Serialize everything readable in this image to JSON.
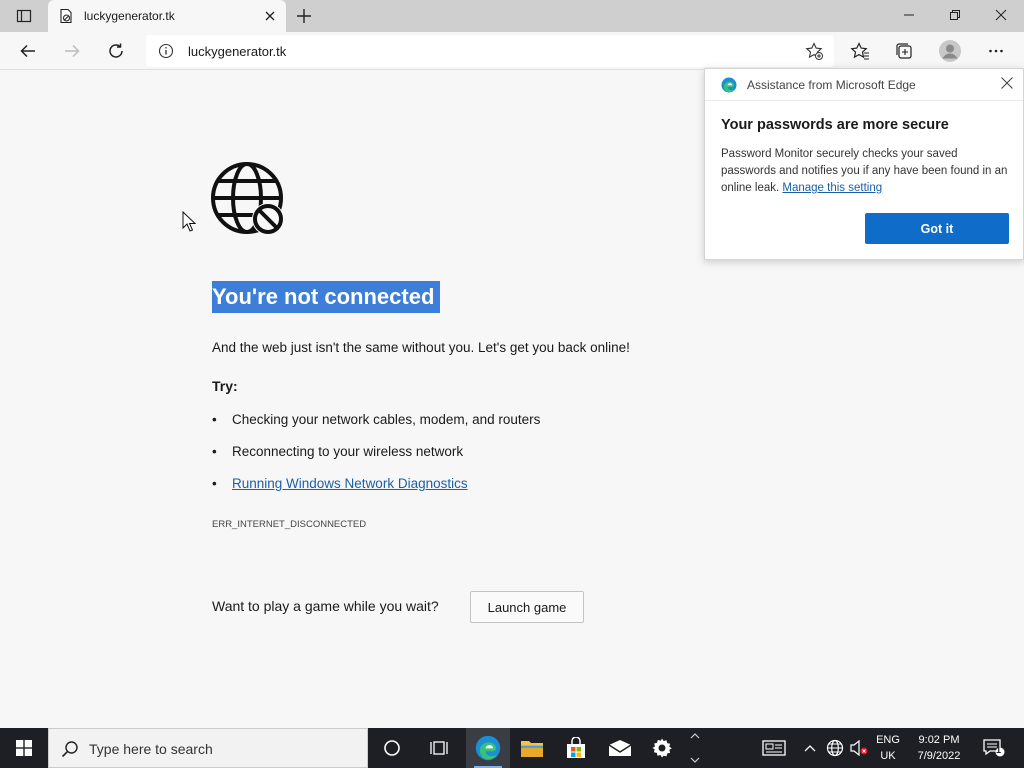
{
  "browser": {
    "tab_title": "luckygenerator.tk",
    "url": "luckygenerator.tk"
  },
  "page": {
    "heading": "You're not connected",
    "subtext": "And the web just isn't the same without you. Let's get you back online!",
    "try_label": "Try:",
    "suggestions": [
      "Checking your network cables, modem, and routers",
      "Reconnecting to your wireless network",
      "Running Windows Network Diagnostics"
    ],
    "error_code": "ERR_INTERNET_DISCONNECTED",
    "game_prompt": "Want to play a game while you wait?",
    "launch_game_label": "Launch game"
  },
  "popup": {
    "title": "Assistance from Microsoft Edge",
    "heading": "Your passwords are more secure",
    "body": "Password Monitor securely checks your saved passwords and notifies you if any have been found in an online leak.",
    "link": "Manage this setting",
    "button": "Got it"
  },
  "taskbar": {
    "search_placeholder": "Type here to search",
    "lang_line1": "ENG",
    "lang_line2": "UK",
    "time": "9:02 PM",
    "date": "7/9/2022",
    "notification_count": "1"
  },
  "colors": {
    "accent": "#0f6cc9",
    "selection": "#3d7fd8",
    "link": "#1b5fa8",
    "taskbar": "#1d1f24"
  }
}
